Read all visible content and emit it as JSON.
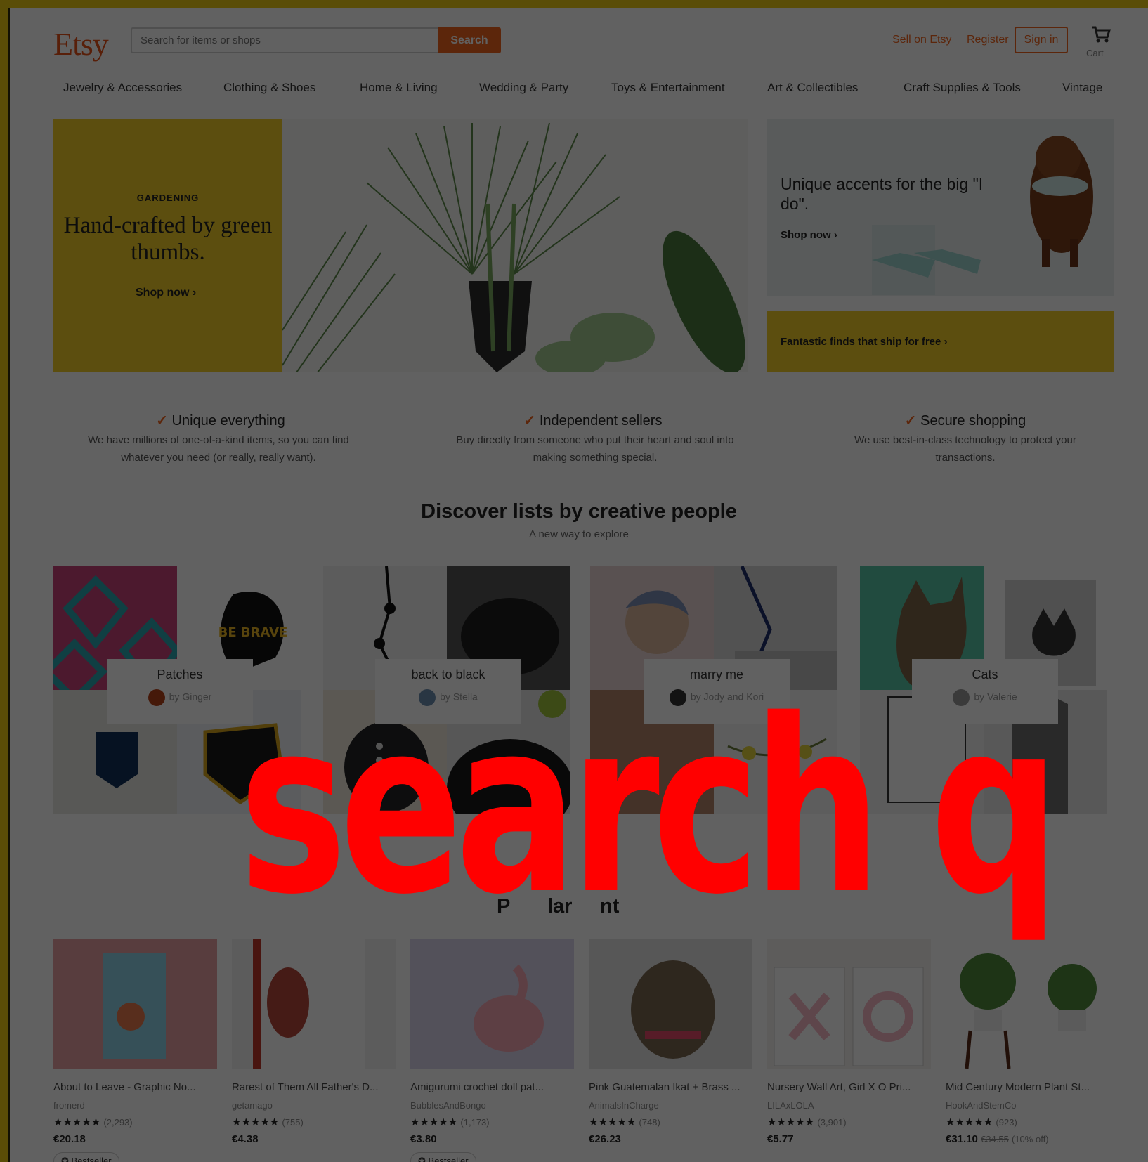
{
  "header": {
    "logo": "Etsy",
    "search_placeholder": "Search for items or shops",
    "search_button": "Search",
    "sell": "Sell on Etsy",
    "register": "Register",
    "signin": "Sign in",
    "cart": "Cart"
  },
  "nav": [
    "Jewelry & Accessories",
    "Clothing & Shoes",
    "Home & Living",
    "Wedding & Party",
    "Toys & Entertainment",
    "Art & Collectibles",
    "Craft Supplies & Tools",
    "Vintage"
  ],
  "hero": {
    "eyebrow": "GARDENING",
    "title": "Hand-crafted by green thumbs.",
    "cta": "Shop now ›"
  },
  "side_promo": {
    "title": "Unique accents for the big \"I do\".",
    "cta": "Shop now ›",
    "banner": "Fantastic finds that ship for free ›"
  },
  "value_props": [
    {
      "title": "Unique everything",
      "body": "We have millions of one-of-a-kind items, so you can find whatever you need (or really, really want)."
    },
    {
      "title": "Independent sellers",
      "body": "Buy directly from someone who put their heart and soul into making something special."
    },
    {
      "title": "Secure shopping",
      "body": "We use best-in-class technology to protect your transactions."
    }
  ],
  "discover": {
    "title": "Discover lists by creative people",
    "subtitle": "A new way to explore",
    "lists": [
      {
        "name": "Patches",
        "by": "by Ginger"
      },
      {
        "name": "back to black",
        "by": "by Stella"
      },
      {
        "name": "marry me",
        "by": "by Jody and Kori"
      },
      {
        "name": "Cats",
        "by": "by Valerie"
      }
    ]
  },
  "popular": {
    "title_fragments": [
      "P",
      "lar",
      "nt"
    ],
    "products": [
      {
        "title": "About to Leave - Graphic No...",
        "shop": "fromerd",
        "stars": "★★★★★",
        "reviews": "(2,293)",
        "price": "€20.18",
        "orig": "",
        "discount": "",
        "badge": "Bestseller"
      },
      {
        "title": "Rarest of Them All Father's D...",
        "shop": "getamago",
        "stars": "★★★★★",
        "reviews": "(755)",
        "price": "€4.38",
        "orig": "",
        "discount": "",
        "badge": ""
      },
      {
        "title": "Amigurumi crochet doll pat...",
        "shop": "BubblesAndBongo",
        "stars": "★★★★★",
        "reviews": "(1,173)",
        "price": "€3.80",
        "orig": "",
        "discount": "",
        "badge": "Bestseller"
      },
      {
        "title": "Pink Guatemalan Ikat + Brass ...",
        "shop": "AnimalsInCharge",
        "stars": "★★★★★",
        "reviews": "(748)",
        "price": "€26.23",
        "orig": "",
        "discount": "",
        "badge": ""
      },
      {
        "title": "Nursery Wall Art, Girl X O Pri...",
        "shop": "LILAxLOLA",
        "stars": "★★★★★",
        "reviews": "(3,901)",
        "price": "€5.77",
        "orig": "",
        "discount": "",
        "badge": ""
      },
      {
        "title": "Mid Century Modern Plant St...",
        "shop": "HookAndStemCo",
        "stars": "★★★★★",
        "reviews": "(923)",
        "price": "€31.10",
        "orig": "€34.55",
        "discount": "(10% off)",
        "badge": ""
      }
    ]
  },
  "patch_text": "BE BRAVE",
  "overlay": "search q",
  "colors": {
    "accent": "#f1641e",
    "promo_yellow": "#f2cd28",
    "overlay_red": "#ff0000"
  }
}
